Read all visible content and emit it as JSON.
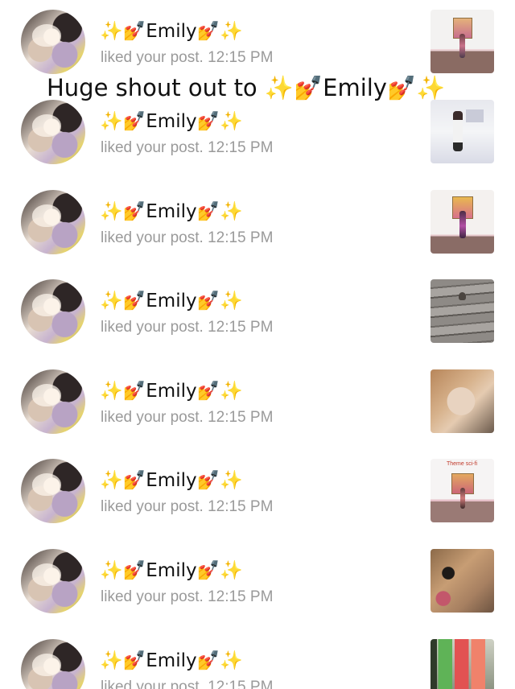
{
  "banner": {
    "text": "Huge shout out to ✨💅Emily💅✨"
  },
  "notifications": [
    {
      "user": "✨💅Emily💅✨",
      "action": "liked your post.",
      "time": "12:15 PM",
      "thumbnail": "room-thumbnail"
    },
    {
      "user": "✨💅Emily💅✨",
      "action": "liked your post.",
      "time": "12:15 PM",
      "thumbnail": "room-thumbnail"
    },
    {
      "user": "✨💅Emily💅✨",
      "action": "liked your post.",
      "time": "12:15 PM",
      "thumbnail": "room-thumbnail"
    },
    {
      "user": "✨💅Emily💅✨",
      "action": "liked your post.",
      "time": "12:15 PM",
      "thumbnail": "deck-thumbnail"
    },
    {
      "user": "✨💅Emily💅✨",
      "action": "liked your post.",
      "time": "12:15 PM",
      "thumbnail": "cat-thumbnail"
    },
    {
      "user": "✨💅Emily💅✨",
      "action": "liked your post.",
      "time": "12:15 PM",
      "thumbnail": "room-thumbnail",
      "thumbnail_caption": "Theme sci-fi"
    },
    {
      "user": "✨💅Emily💅✨",
      "action": "liked your post.",
      "time": "12:15 PM",
      "thumbnail": "dog-thumbnail"
    },
    {
      "user": "✨💅Emily💅✨",
      "action": "liked your post.",
      "time": "12:15 PM",
      "thumbnail": "jars-thumbnail"
    }
  ]
}
